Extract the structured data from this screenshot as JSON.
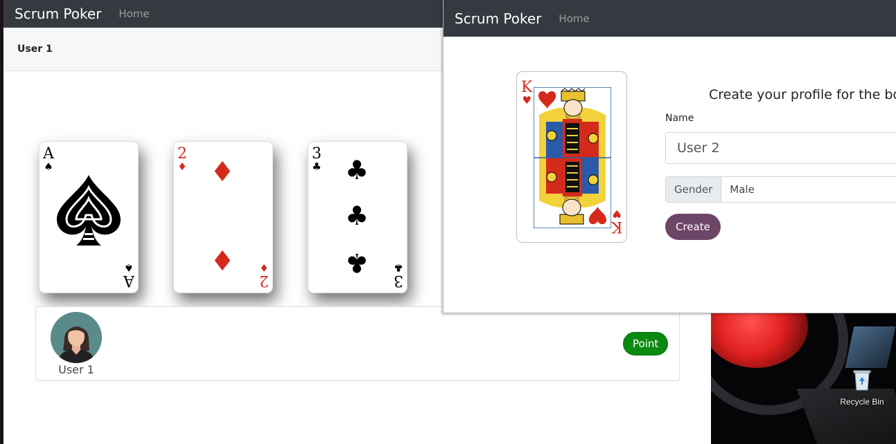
{
  "back_window": {
    "brand": "Scrum Poker",
    "nav_home": "Home",
    "user_bar_name": "User 1",
    "cards": [
      {
        "rank": "A",
        "suit": "♠",
        "color": "#000000"
      },
      {
        "rank": "2",
        "suit": "♦",
        "color": "#d42a1c"
      },
      {
        "rank": "3",
        "suit": "♣",
        "color": "#000000"
      }
    ],
    "player": {
      "name": "User 1",
      "point_button": "Point",
      "point_color": "#0b8a12"
    }
  },
  "front_window": {
    "brand": "Scrum Poker",
    "nav_home": "Home",
    "card": {
      "rank": "K",
      "suit": "♥",
      "color": "#d42a1c"
    },
    "title": "Create your profile for the boa",
    "name_label": "Name",
    "name_value": "User 2",
    "gender_label": "Gender",
    "gender_value": "Male",
    "create_button": "Create",
    "create_color": "#6d4566"
  },
  "desktop": {
    "recycle_bin_label": "Recycle Bin"
  }
}
